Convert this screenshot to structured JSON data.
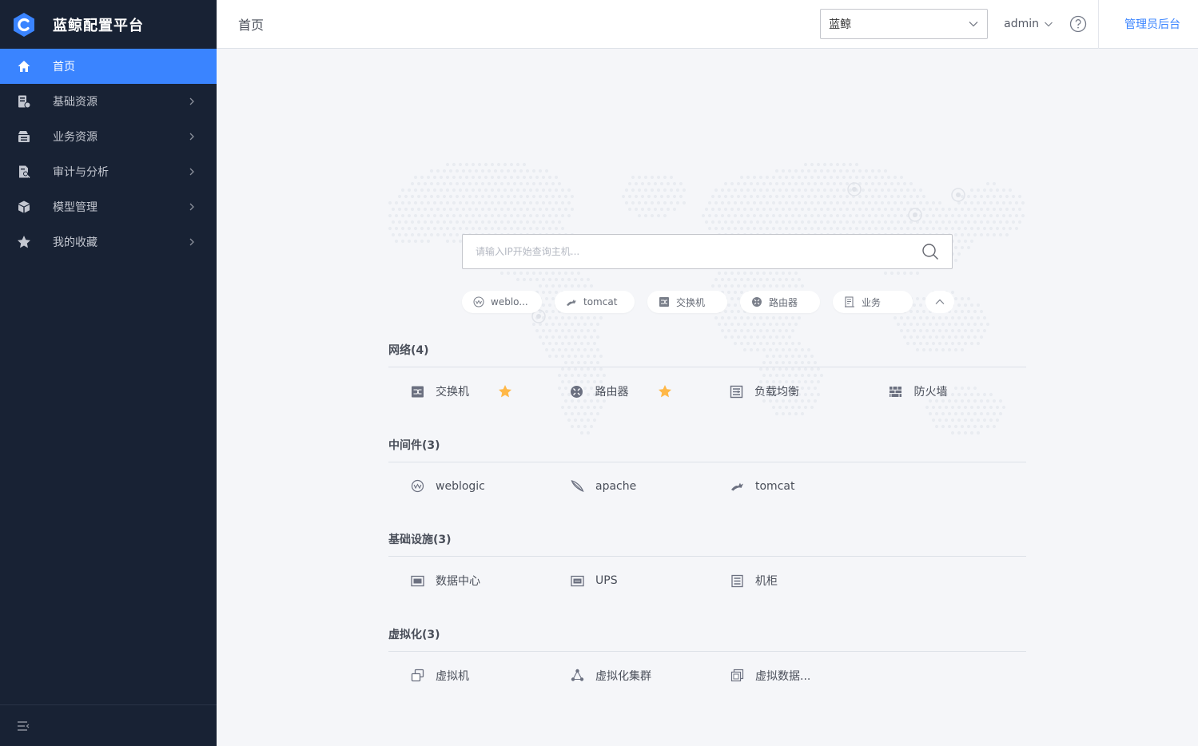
{
  "app": {
    "title": "蓝鲸配置平台"
  },
  "sidebar": {
    "items": [
      {
        "label": "首页",
        "icon": "home-icon",
        "active": true
      },
      {
        "label": "基础资源",
        "icon": "host-resource-icon"
      },
      {
        "label": "业务资源",
        "icon": "business-resource-icon"
      },
      {
        "label": "审计与分析",
        "icon": "audit-icon"
      },
      {
        "label": "模型管理",
        "icon": "cube-icon"
      },
      {
        "label": "我的收藏",
        "icon": "star-icon"
      }
    ]
  },
  "header": {
    "page_title": "首页",
    "business_selected": "蓝鲸",
    "user": "admin",
    "admin_link": "管理员后台"
  },
  "search": {
    "placeholder": "请输入IP开始查询主机..."
  },
  "quick_chips": [
    {
      "label": "weblo...",
      "icon": "weblogic-icon"
    },
    {
      "label": "tomcat",
      "icon": "tomcat-icon"
    },
    {
      "label": "交换机",
      "icon": "switch-icon"
    },
    {
      "label": "路由器",
      "icon": "router-icon"
    },
    {
      "label": "业务",
      "icon": "business-icon"
    }
  ],
  "groups": [
    {
      "title": "网络(4)",
      "models": [
        {
          "label": "交换机",
          "icon": "switch-icon",
          "starred": true
        },
        {
          "label": "路由器",
          "icon": "router-icon",
          "starred": true
        },
        {
          "label": "负载均衡",
          "icon": "load-balancer-icon",
          "starred": false
        },
        {
          "label": "防火墙",
          "icon": "firewall-icon",
          "starred": false
        }
      ]
    },
    {
      "title": "中间件(3)",
      "models": [
        {
          "label": "weblogic",
          "icon": "weblogic-icon"
        },
        {
          "label": "apache",
          "icon": "apache-icon"
        },
        {
          "label": "tomcat",
          "icon": "tomcat-icon"
        }
      ]
    },
    {
      "title": "基础设施(3)",
      "models": [
        {
          "label": "数据中心",
          "icon": "datacenter-icon"
        },
        {
          "label": "UPS",
          "icon": "ups-icon"
        },
        {
          "label": "机柜",
          "icon": "cabinet-icon"
        }
      ]
    },
    {
      "title": "虚拟化(3)",
      "models": [
        {
          "label": "虚拟机",
          "icon": "virtual-machine-icon"
        },
        {
          "label": "虚拟化集群",
          "icon": "virtual-cluster-icon"
        },
        {
          "label": "虚拟数据...",
          "icon": "virtual-datacenter-icon"
        }
      ]
    }
  ],
  "colors": {
    "sidebar_bg": "#182234",
    "accent": "#3a84ff",
    "star": "#ffb848"
  }
}
